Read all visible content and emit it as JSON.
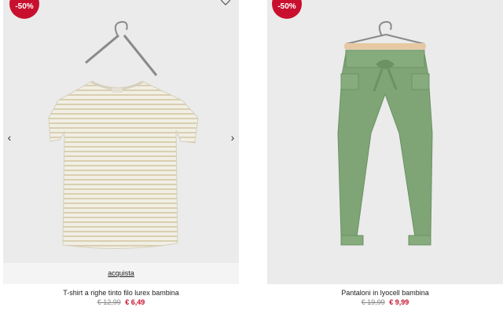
{
  "products": [
    {
      "badge": "-50%",
      "action_label": "acquista",
      "name": "T-shirt a righe tinto filo lurex bambina",
      "old_price": "€ 12,99",
      "new_price": "€ 6,49"
    },
    {
      "badge": "-50%",
      "name": "Pantaloni in lyocell bambina",
      "old_price": "€ 19,99",
      "new_price": "€ 9,99"
    }
  ],
  "colors": {
    "badge": "#c8102e",
    "sale_price": "#c8102e",
    "image_background": "#ebebeb"
  },
  "icons": {
    "carousel_prev": "chevron-left-icon",
    "carousel_next": "chevron-right-icon",
    "wishlist": "heart-icon"
  }
}
